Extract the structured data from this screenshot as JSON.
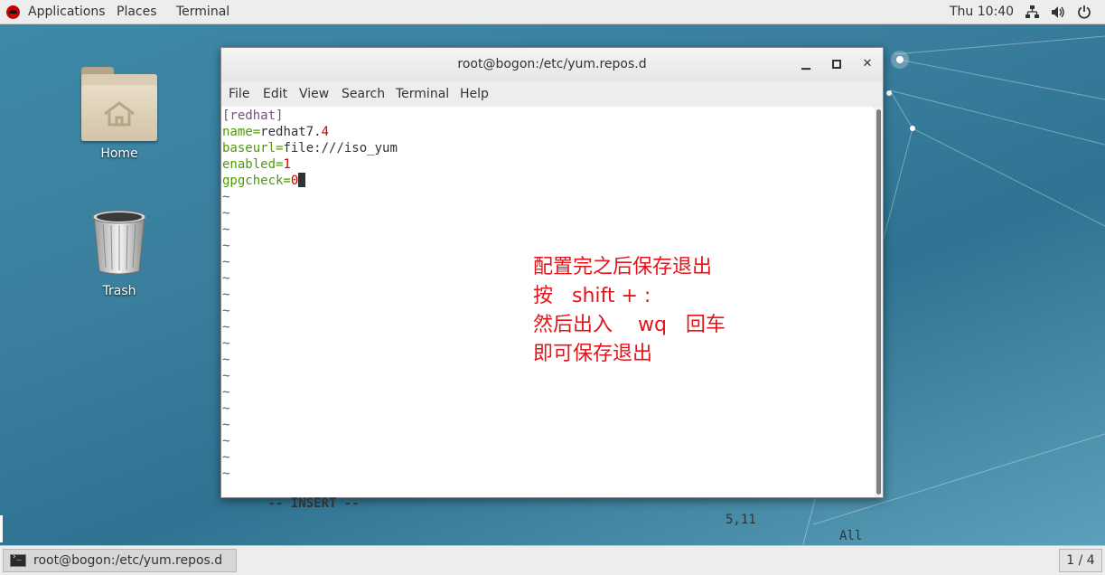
{
  "topbar": {
    "applications": "Applications",
    "places": "Places",
    "terminal": "Terminal",
    "clock": "Thu 10:40",
    "icons": [
      "network-icon",
      "volume-icon",
      "power-icon"
    ]
  },
  "desktop": {
    "home_label": "Home",
    "trash_label": "Trash"
  },
  "window": {
    "title": "root@bogon:/etc/yum.repos.d",
    "minimize": "▁",
    "maximize": "□",
    "close": "✕",
    "menu": [
      "File",
      "Edit",
      "View",
      "Search",
      "Terminal",
      "Help"
    ]
  },
  "editor": {
    "line1": "[redhat]",
    "line2_key": "name=",
    "line2_val_a": "redhat7.",
    "line2_val_b": "4",
    "line3_key": "baseurl=",
    "line3_val": "file:///iso_yum",
    "line4_key": "enabled=",
    "line4_val": "1",
    "line5_key": "gpgcheck=",
    "line5_val": "0",
    "tilde": "~",
    "status_mode": "-- INSERT --",
    "status_pos": "5,11",
    "status_scroll": "All"
  },
  "annotation": {
    "line1": "配置完之后保存退出",
    "line2": "按   shift + :",
    "line3": "然后出入    wq   回车",
    "line4": "即可保存退出"
  },
  "taskbar": {
    "task_label": "root@bogon:/etc/yum.repos.d",
    "pager": "1 / 4"
  },
  "colors": {
    "section": "#75507b",
    "key": "#4e9a06",
    "number": "#cc0000",
    "annotation": "#e4141b"
  }
}
